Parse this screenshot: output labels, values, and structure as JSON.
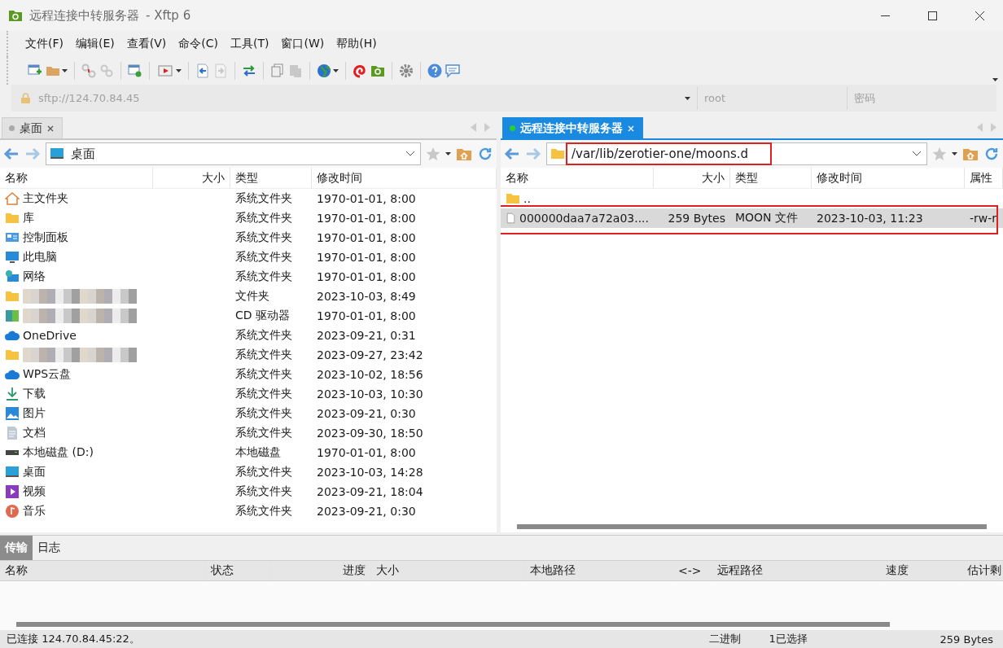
{
  "window": {
    "title": "远程连接中转服务器",
    "app": "- Xftp 6"
  },
  "menu": [
    "文件(F)",
    "编辑(E)",
    "查看(V)",
    "命令(C)",
    "工具(T)",
    "窗口(W)",
    "帮助(H)"
  ],
  "toolbar": [
    [
      {
        "kind": "new-window",
        "disabled": false,
        "dropdown": false
      },
      {
        "kind": "folder",
        "disabled": false,
        "dropdown": true
      }
    ],
    [
      {
        "kind": "disconnect",
        "disabled": false,
        "dropdown": false
      },
      {
        "kind": "link",
        "disabled": true,
        "dropdown": false
      }
    ],
    [
      {
        "kind": "window-gear",
        "disabled": false,
        "dropdown": false
      }
    ],
    [
      {
        "kind": "play",
        "disabled": false,
        "dropdown": true
      }
    ],
    [
      {
        "kind": "upload",
        "disabled": false,
        "dropdown": false
      },
      {
        "kind": "download",
        "disabled": true,
        "dropdown": false
      }
    ],
    [
      {
        "kind": "sync",
        "disabled": false,
        "dropdown": false
      }
    ],
    [
      {
        "kind": "copy",
        "disabled": false,
        "dropdown": false
      },
      {
        "kind": "paste",
        "disabled": true,
        "dropdown": false
      }
    ],
    [
      {
        "kind": "globe",
        "disabled": false,
        "dropdown": true
      }
    ],
    [
      {
        "kind": "swirl",
        "disabled": false,
        "dropdown": false
      },
      {
        "kind": "green-folder",
        "disabled": false,
        "dropdown": false
      }
    ],
    [
      {
        "kind": "gear",
        "disabled": false,
        "dropdown": false
      }
    ],
    [
      {
        "kind": "help",
        "disabled": false,
        "dropdown": false
      },
      {
        "kind": "chat",
        "disabled": false,
        "dropdown": false
      }
    ]
  ],
  "address": {
    "placeholder": "sftp://124.70.84.45",
    "user_placeholder": "root",
    "password_placeholder": "密码"
  },
  "left_panel": {
    "tab": {
      "label": "桌面",
      "selected": false
    },
    "path": {
      "value": "桌面",
      "highlighted": false
    },
    "columns": [
      "名称",
      "大小",
      "类型",
      "修改时间"
    ],
    "rows": [
      {
        "kind": "home",
        "name": "主文件夹",
        "type": "系统文件夹",
        "modified": "1970-01-01, 8:00",
        "selected": false,
        "redacted": false
      },
      {
        "kind": "folder",
        "name": "库",
        "type": "系统文件夹",
        "modified": "1970-01-01, 8:00",
        "selected": false,
        "redacted": false
      },
      {
        "kind": "control-panel",
        "name": "控制面板",
        "type": "系统文件夹",
        "modified": "1970-01-01, 8:00",
        "selected": false,
        "redacted": false
      },
      {
        "kind": "computer",
        "name": "此电脑",
        "type": "系统文件夹",
        "modified": "1970-01-01, 8:00",
        "selected": false,
        "redacted": false
      },
      {
        "kind": "network",
        "name": "网络",
        "type": "系统文件夹",
        "modified": "1970-01-01, 8:00",
        "selected": false,
        "redacted": false
      },
      {
        "kind": "folder",
        "type": "文件夹",
        "modified": "2023-10-03, 8:49",
        "selected": false,
        "redacted": true
      },
      {
        "kind": "drive",
        "type": "CD 驱动器",
        "modified": "1970-01-01, 8:00",
        "selected": false,
        "redacted": true
      },
      {
        "kind": "cloud",
        "name": "OneDrive",
        "type": "系统文件夹",
        "modified": "2023-09-21, 0:31",
        "selected": false,
        "redacted": false
      },
      {
        "kind": "folder",
        "type": "系统文件夹",
        "modified": "2023-09-27, 23:42",
        "selected": false,
        "redacted": true
      },
      {
        "kind": "cloud",
        "name": "WPS云盘",
        "type": "系统文件夹",
        "modified": "2023-10-02, 18:56",
        "selected": false,
        "redacted": false
      },
      {
        "kind": "download",
        "name": "下载",
        "type": "系统文件夹",
        "modified": "2023-10-03, 10:30",
        "selected": false,
        "redacted": false
      },
      {
        "kind": "picture",
        "name": "图片",
        "type": "系统文件夹",
        "modified": "2023-09-21, 0:30",
        "selected": false,
        "redacted": false
      },
      {
        "kind": "document",
        "name": "文档",
        "type": "系统文件夹",
        "modified": "2023-09-30, 18:50",
        "selected": false,
        "redacted": false
      },
      {
        "kind": "disk",
        "name": "本地磁盘 (D:)",
        "type": "本地磁盘",
        "modified": "1970-01-01, 8:00",
        "selected": false,
        "redacted": false
      },
      {
        "kind": "desktop",
        "name": "桌面",
        "type": "系统文件夹",
        "modified": "2023-10-03, 14:28",
        "selected": false,
        "redacted": false
      },
      {
        "kind": "video",
        "name": "视频",
        "type": "系统文件夹",
        "modified": "2023-09-21, 18:04",
        "selected": false,
        "redacted": false
      },
      {
        "kind": "music",
        "name": "音乐",
        "type": "系统文件夹",
        "modified": "2023-09-21, 0:30",
        "selected": false,
        "redacted": false
      }
    ]
  },
  "right_panel": {
    "tab": {
      "label": "远程连接中转服务器",
      "selected": true
    },
    "path": {
      "value": "/var/lib/zerotier-one/moons.d",
      "highlighted": true
    },
    "columns": [
      "名称",
      "大小",
      "类型",
      "修改时间",
      "属性"
    ],
    "rows": [
      {
        "kind": "folder",
        "name": "..",
        "selected": false,
        "highlighted": false
      },
      {
        "kind": "file",
        "name": "000000daa7a72a03....",
        "size": "259 Bytes",
        "type": "MOON 文件",
        "modified": "2023-10-03, 11:23",
        "attributes": "-rw-r",
        "selected": true,
        "highlighted": true
      }
    ]
  },
  "transfer": {
    "tabs": [
      {
        "label": "传输",
        "selected": true
      },
      {
        "label": "日志",
        "selected": false
      }
    ],
    "columns": [
      "名称",
      "状态",
      "进度",
      "大小",
      "本地路径",
      "<->",
      "远程路径",
      "速度",
      "估计剩"
    ]
  },
  "status_bar": {
    "connection": "已连接 124.70.84.45:22。",
    "mode": "二进制",
    "selection": "1已选择",
    "size": "259 Bytes"
  }
}
